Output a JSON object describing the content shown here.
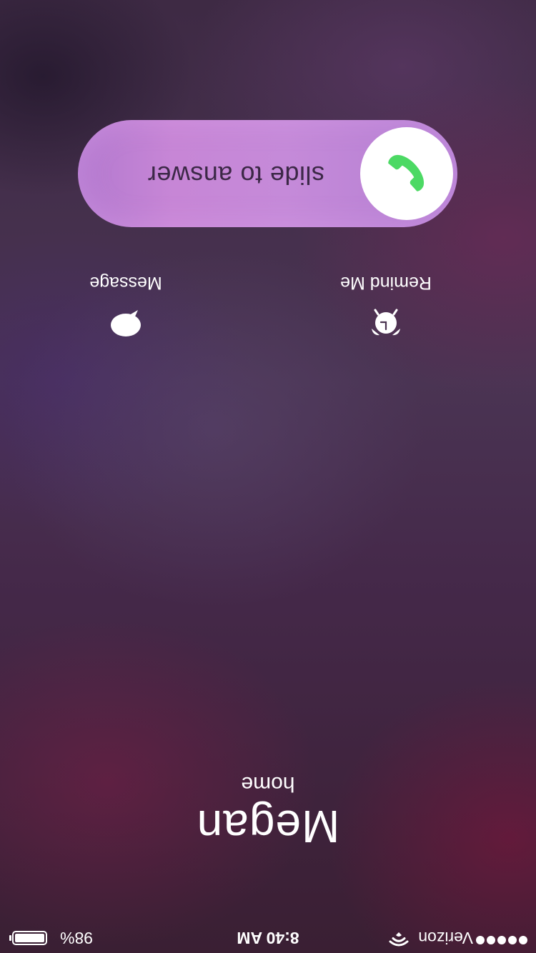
{
  "status_bar": {
    "carrier": "Verizon",
    "time": "8:40 AM",
    "battery_percent": "98%",
    "signal_icon": "signal-dots-icon",
    "wifi_icon": "wifi-icon",
    "battery_icon": "battery-icon"
  },
  "caller": {
    "name": "Megan",
    "label": "home"
  },
  "actions": {
    "remind": {
      "label": "Remind Me",
      "icon": "alarm-clock-icon"
    },
    "message": {
      "label": "Message",
      "icon": "speech-bubble-icon"
    }
  },
  "slider": {
    "text": "slide to answer",
    "icon": "phone-icon",
    "icon_color": "#4cd964"
  },
  "colors": {
    "slider_bg": "#c58ad9",
    "knob": "#ffffff",
    "accept_green": "#4cd964"
  }
}
